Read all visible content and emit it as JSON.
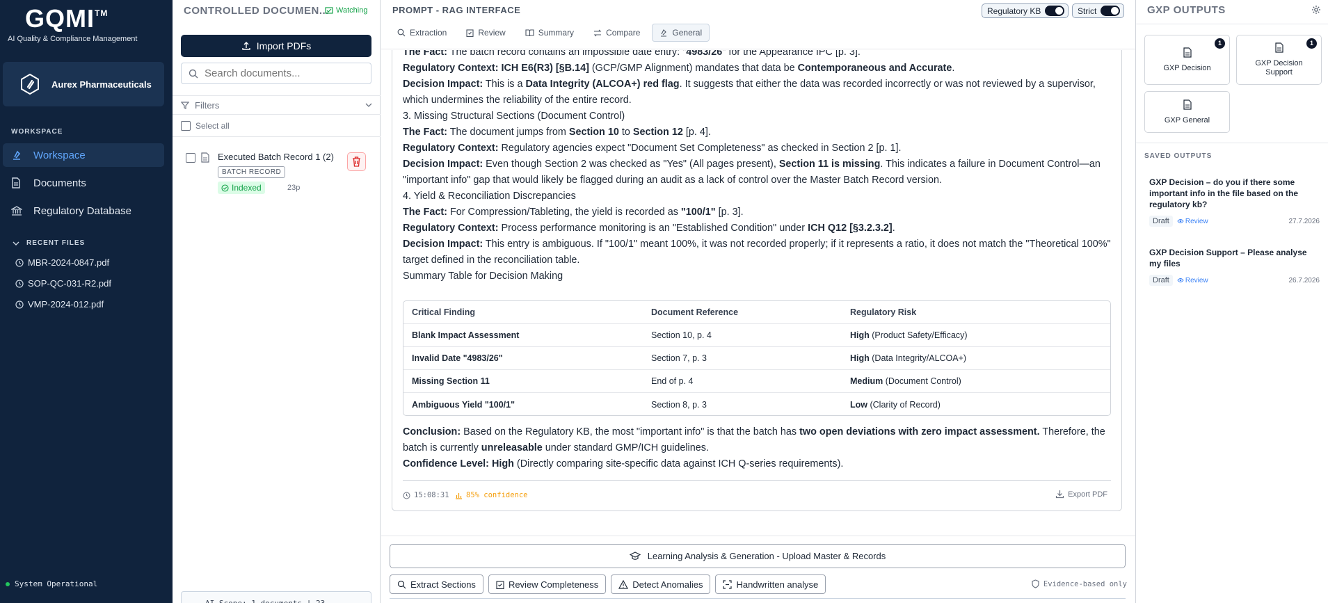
{
  "brand": {
    "logo": "GQMI",
    "tm": "TM",
    "tagline": "AI Quality & Compliance Management"
  },
  "org": {
    "name": "Aurex Pharmaceuticals"
  },
  "sidebar": {
    "section": "WORKSPACE",
    "items": [
      {
        "label": "Workspace",
        "icon": "workspace-icon",
        "active": true
      },
      {
        "label": "Documents",
        "icon": "document-icon"
      },
      {
        "label": "Regulatory Database",
        "icon": "bank-icon"
      }
    ],
    "recent_label": "RECENT FILES",
    "recent": [
      "MBR-2024-0847.pdf",
      "SOP-QC-031-R2.pdf",
      "VMP-2024-012.pdf"
    ],
    "status": "System Operational"
  },
  "docs": {
    "title": "CONTROLLED DOCUMEN...",
    "watching": "Watching",
    "import_label": "Import PDFs",
    "search_placeholder": "Search documents...",
    "filters_label": "Filters",
    "select_all": "Select all",
    "items": [
      {
        "title": "Executed Batch Record 1 (2)",
        "tag": "BATCH RECORD",
        "status": "Indexed",
        "pages": "23p"
      }
    ],
    "scope": "AI Scope: 1 documents | 23"
  },
  "main": {
    "title": "PROMPT - RAG INTERFACE",
    "tabs": [
      "Extraction",
      "Review",
      "Summary",
      "Compare",
      "General"
    ],
    "active_tab": "General",
    "toggles": [
      {
        "label": "Regulatory KB",
        "on": true
      },
      {
        "label": "Strict",
        "on": true
      }
    ],
    "content": {
      "l1_a": "The Fact:",
      "l1_b": " The batch record contains an impossible date entry: \"",
      "l1_c": "4983/26",
      "l1_d": "\" for the Appearance IPC [p. 3].",
      "l2_a": "Regulatory Context:",
      "l2_b": " ICH E6(R3) [§B.14]",
      "l2_c": " (GCP/GMP Alignment) mandates that data be ",
      "l2_d": "Contemporaneous and Accurate",
      "l2_e": ".",
      "l3_a": "Decision Impact:",
      "l3_b": " This is a ",
      "l3_c": "Data Integrity (ALCOA+) red flag",
      "l3_d": ". It suggests that either the data was recorded incorrectly or was not reviewed by a supervisor, which undermines the reliability of the entire record.",
      "h3": "3. Missing Structural Sections (Document Control)",
      "l4_a": "The Fact:",
      "l4_b": " The document jumps from ",
      "l4_c": "Section 10",
      "l4_d": " to ",
      "l4_e": "Section 12",
      "l4_f": " [p. 4].",
      "l5_a": "Regulatory Context:",
      "l5_b": " Regulatory agencies expect \"Document Set Completeness\" as checked in Section 2 [p. 1].",
      "l6_a": "Decision Impact:",
      "l6_b": " Even though Section 2 was checked as \"Yes\" (All pages present), ",
      "l6_c": "Section 11 is missing",
      "l6_d": ". This indicates a failure in Document Control—an \"important info\" gap that would likely be flagged during an audit as a lack of control over the Master Batch Record version.",
      "h4": "4. Yield & Reconciliation Discrepancies",
      "l7_a": "The Fact:",
      "l7_b": " For Compression/Tableting, the yield is recorded as ",
      "l7_c": "\"100/1\"",
      "l7_d": " [p. 3].",
      "l8_a": "Regulatory Context:",
      "l8_b": " Process performance monitoring is an \"Established Condition\" under ",
      "l8_c": "ICH Q12 [§3.2.3.2]",
      "l8_d": ".",
      "l9_a": "Decision Impact:",
      "l9_b": " This entry is ambiguous. If \"100/1\" meant 100%, it was not recorded properly; if it represents a ratio, it does not match the \"Theoretical 100%\" target defined in the reconciliation table.",
      "h5": "Summary Table for Decision Making"
    },
    "table": {
      "headers": [
        "Critical Finding",
        "Document Reference",
        "Regulatory Risk"
      ],
      "rows": [
        {
          "finding": "Blank Impact Assessment",
          "ref": "Section 10, p. 4",
          "risk": "High",
          "risk_note": " (Product Safety/Efficacy)"
        },
        {
          "finding": "Invalid Date \"4983/26\"",
          "ref": "Section 7, p. 3",
          "risk": "High",
          "risk_note": " (Data Integrity/ALCOA+)"
        },
        {
          "finding": "Missing Section 11",
          "ref": "End of p. 4",
          "risk": "Medium",
          "risk_note": " (Document Control)"
        },
        {
          "finding": "Ambiguous Yield \"100/1\"",
          "ref": "Section 8, p. 3",
          "risk": "Low",
          "risk_note": " (Clarity of Record)"
        }
      ]
    },
    "conclusion": {
      "a": "Conclusion:",
      "b": " Based on the Regulatory KB, the most \"important info\" is that the batch has ",
      "c": "two open deviations with zero impact assessment.",
      "d": " Therefore, the batch is currently ",
      "e": "unreleasable",
      "f": " under standard GMP/ICH guidelines.",
      "conf_a": "Confidence Level:",
      "conf_b": " High",
      "conf_c": " (Directly comparing site-specific data against ICH Q-series requirements)."
    },
    "footer": {
      "time": "15:08:31",
      "confidence": "85% confidence",
      "export": "Export PDF"
    },
    "learn_label": "Learning Analysis & Generation - Upload Master & Records",
    "actions": [
      "Extract Sections",
      "Review Completeness",
      "Detect Anomalies",
      "Handwritten analyse"
    ],
    "evidence": "Evidence-based only"
  },
  "right": {
    "title": "GXP OUTPUTS",
    "cards": [
      {
        "label": "GXP Decision",
        "count": "1"
      },
      {
        "label": "GXP Decision Support",
        "count": "1"
      },
      {
        "label": "GXP General",
        "count": ""
      }
    ],
    "saved_label": "SAVED OUTPUTS",
    "saved": [
      {
        "title": "GXP Decision – do you if there some important info in the file based on the regulatory kb?",
        "status": "Draft",
        "action": "Review",
        "date": "27.7.2026"
      },
      {
        "title": "GXP Decision Support – Please analyse my files",
        "status": "Draft",
        "action": "Review",
        "date": "26.7.2026"
      }
    ]
  }
}
